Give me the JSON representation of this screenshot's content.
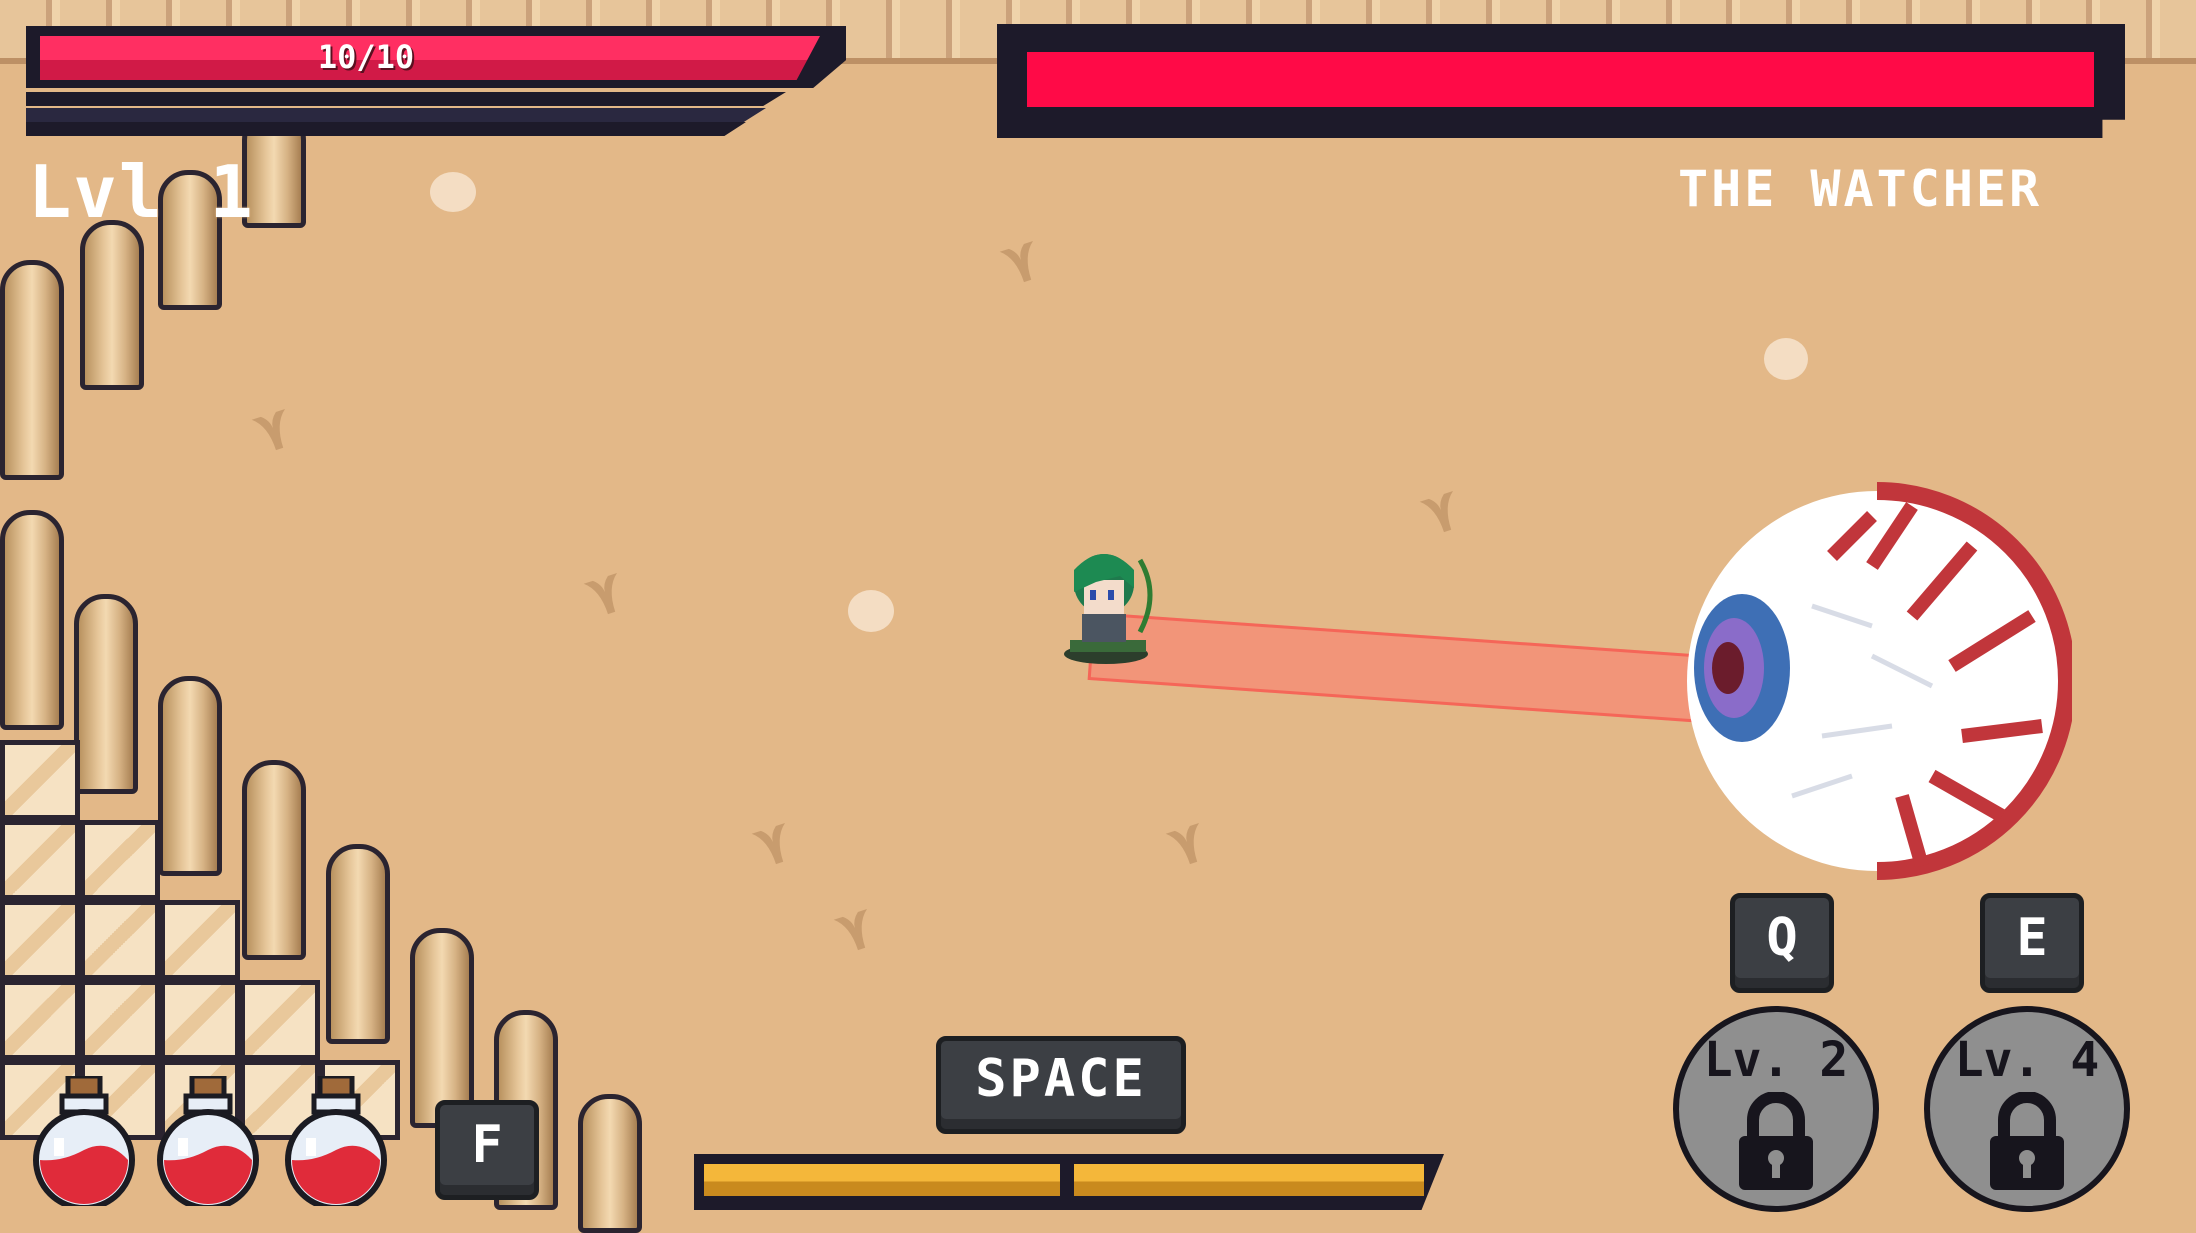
{
  "hud": {
    "player_hp_text": "10/10",
    "player_hp_fraction": 1.0,
    "level_text": "Lvl 1",
    "boss_hp_fraction": 1.0,
    "boss_name": "THE WATCHER"
  },
  "controls": {
    "space_label": "SPACE",
    "f_label": "F",
    "q_label": "Q",
    "e_label": "E",
    "skill_q_level": "Lv. 2",
    "skill_e_level": "Lv. 4"
  },
  "stamina": {
    "segments": 2,
    "fraction": 1.0
  },
  "potions": {
    "count": 3
  },
  "colors": {
    "hp_red": "#ff2f62",
    "boss_red": "#ff0a47",
    "stamina_yellow": "#f4b73a",
    "sand": "#e3b888",
    "ui_dark": "#1d1a2a"
  }
}
